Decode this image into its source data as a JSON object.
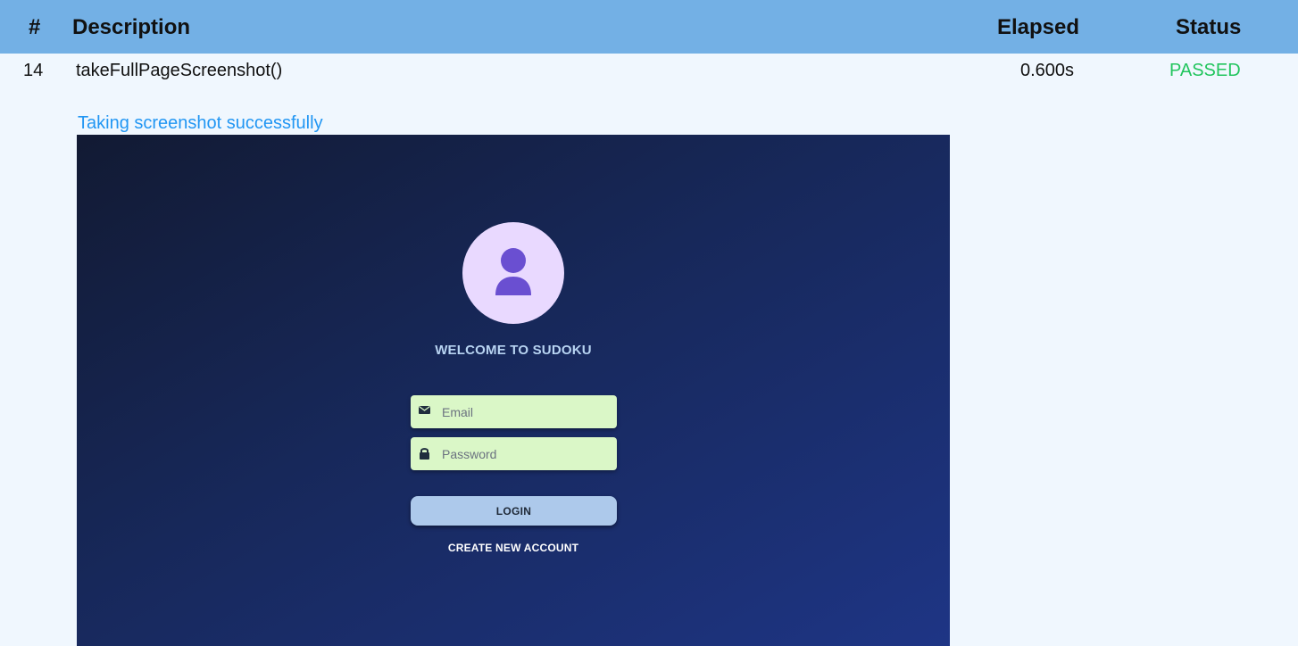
{
  "table": {
    "headers": {
      "num": "#",
      "description": "Description",
      "elapsed": "Elapsed",
      "status": "Status"
    },
    "row": {
      "num": "14",
      "description": "takeFullPageScreenshot()",
      "elapsed": "0.600s",
      "status": "PASSED"
    }
  },
  "log": {
    "message": "Taking screenshot successfully"
  },
  "screenshot": {
    "welcome_text": "WELCOME TO SUDOKU",
    "email_placeholder": "Email",
    "password_placeholder": "Password",
    "login_label": "LOGIN",
    "create_account_label": "CREATE NEW ACCOUNT",
    "icons": {
      "avatar": "user-icon",
      "email": "envelope-icon",
      "password": "lock-icon"
    }
  },
  "colors": {
    "header_bg": "#73b0e5",
    "page_bg": "#f0f7fe",
    "status_passed": "#22c55e",
    "log_text": "#2196f3",
    "avatar_bg": "#e9d9ff",
    "avatar_icon": "#6a4fd1",
    "field_bg": "#daf7c7",
    "login_bg": "#adc9eb"
  }
}
